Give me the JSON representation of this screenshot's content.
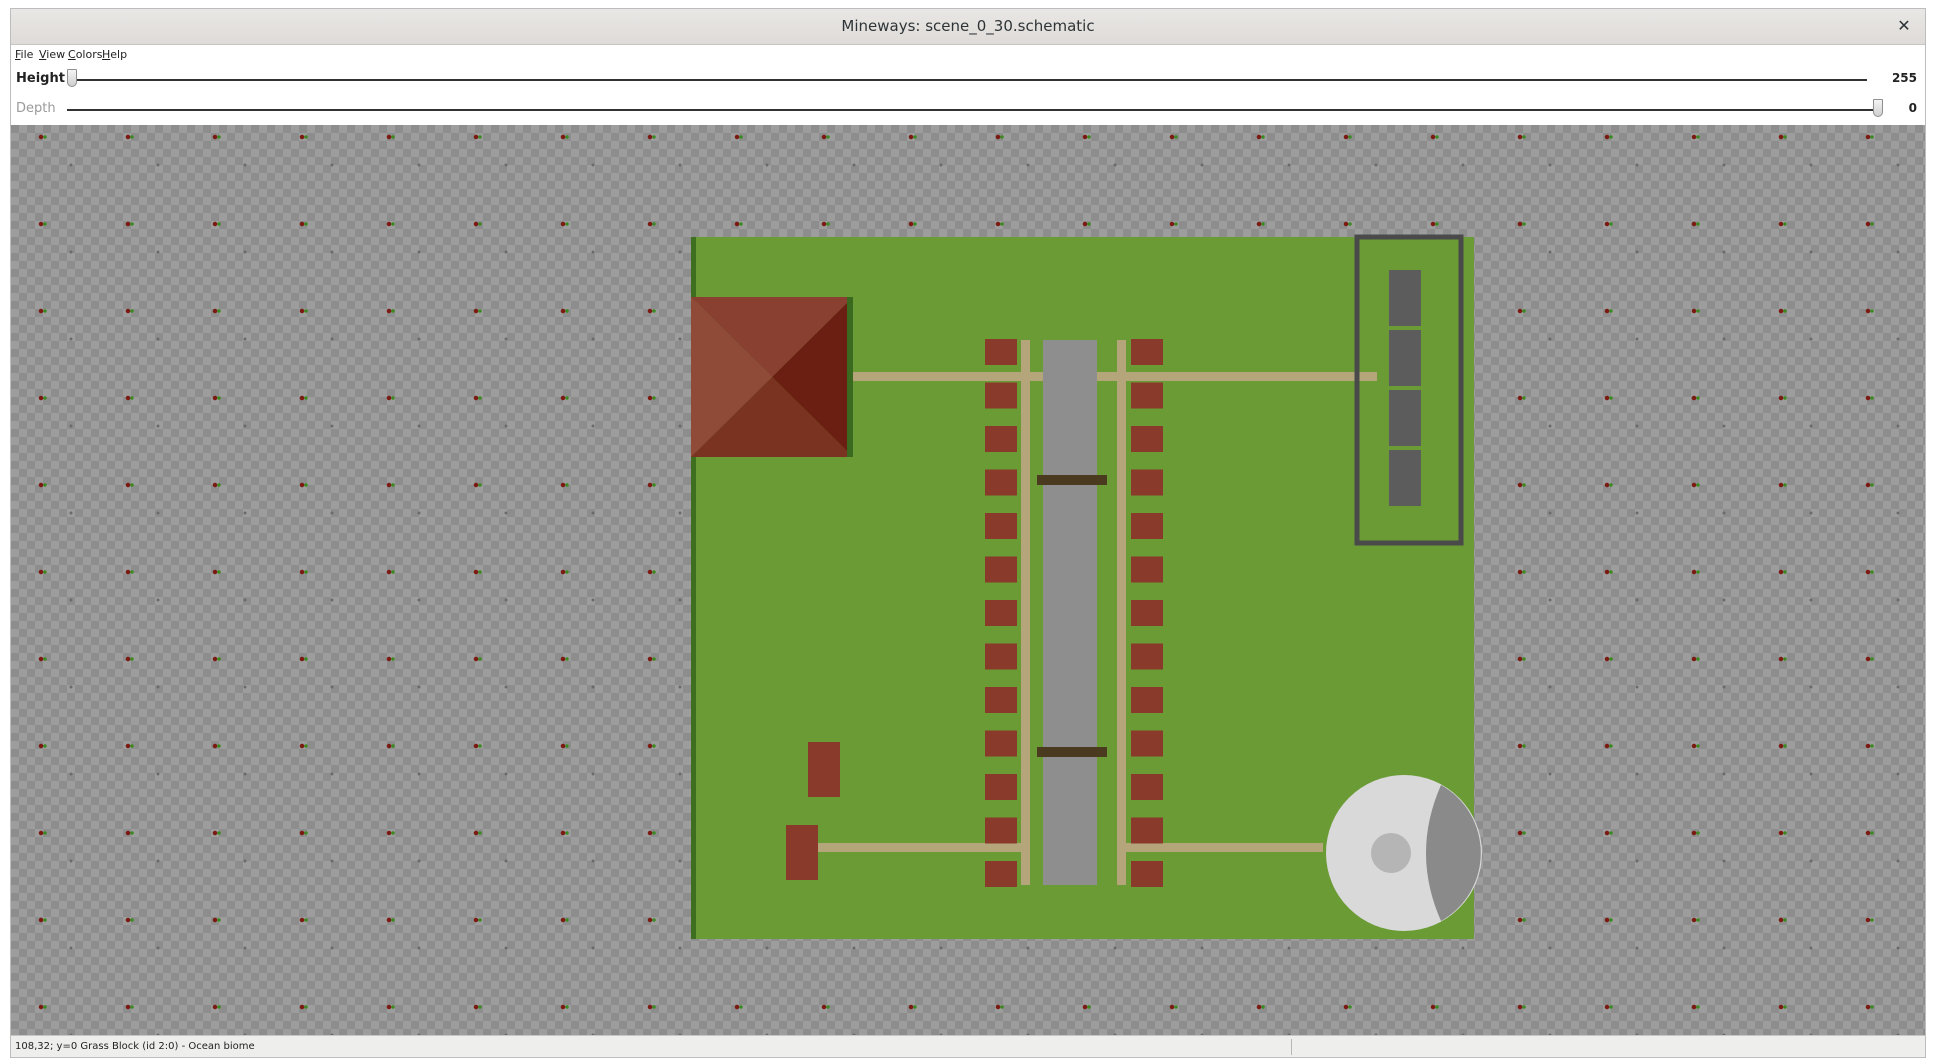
{
  "window": {
    "title": "Mineways: scene_0_30.schematic",
    "close_glyph": "✕"
  },
  "menubar": {
    "items": [
      {
        "label_u": "F",
        "label_rest": "ile"
      },
      {
        "label_u": "V",
        "label_rest": "iew"
      },
      {
        "label_u": "C",
        "label_rest": "olors"
      },
      {
        "label_u": "H",
        "label_rest": "elp"
      }
    ]
  },
  "height_slider": {
    "label": "Height",
    "value": "255"
  },
  "depth_slider": {
    "label": "Depth",
    "value": "0"
  },
  "map": {
    "icons": {
      "grass": "grass-block",
      "roof": "brick-roof",
      "rails": "rails",
      "stone_sphere": "stone-sphere",
      "furnace": "furnace-column"
    },
    "colors": {
      "grass": "#6a9b35",
      "grass_edge": "#3e6f1e",
      "brick": "#8a3a2a",
      "rail": "#b4a57a",
      "stone": "#777777",
      "background": "#8d8d8d"
    }
  },
  "status": {
    "text": "108,32; y=0 Grass Block (id 2:0) - Ocean biome"
  }
}
